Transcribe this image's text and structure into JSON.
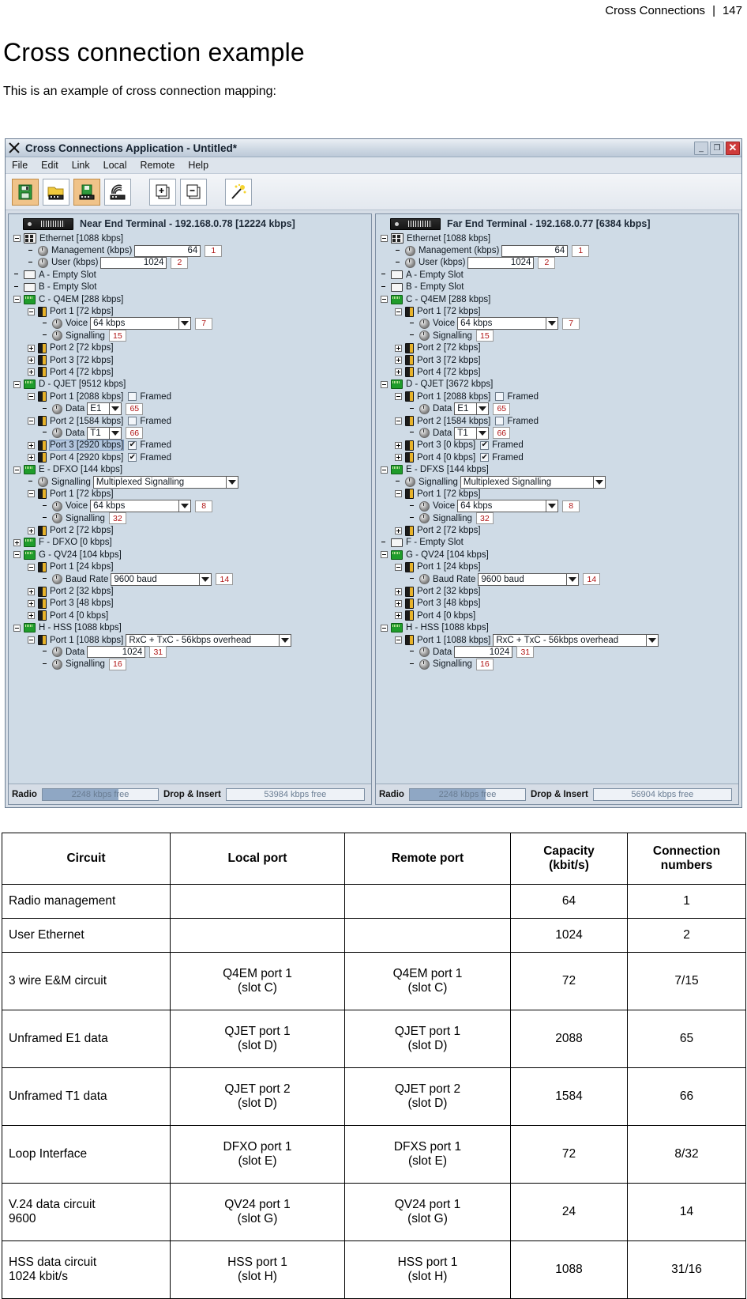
{
  "page_header": {
    "title": "Cross Connections",
    "separator": "|",
    "page_number": "147"
  },
  "document": {
    "heading": "Cross connection example",
    "intro": "This is an example of cross connection mapping:"
  },
  "app": {
    "title": "Cross Connections Application - Untitled*",
    "window_buttons": {
      "minimize": "_",
      "maximize": "❐",
      "close": "✕"
    },
    "menus": [
      "File",
      "Edit",
      "Link",
      "Local",
      "Remote",
      "Help"
    ],
    "toolbar": [
      {
        "name": "save-button",
        "icon": "floppy-disk-icon",
        "active": true
      },
      {
        "name": "open-button",
        "icon": "open-folder-icon",
        "active": false
      },
      {
        "name": "upload-terminal-button",
        "icon": "terminal-save-icon",
        "active": true
      },
      {
        "name": "radio-link-button",
        "icon": "radio-wave-icon",
        "active": false
      },
      {
        "name": "add-connection-button",
        "icon": "add-page-icon",
        "active": false
      },
      {
        "name": "remove-connection-button",
        "icon": "remove-page-icon",
        "active": false
      },
      {
        "name": "wizard-button",
        "icon": "magic-wand-icon",
        "active": false
      }
    ]
  },
  "near_end": {
    "pane_title": "Near End Terminal - 192.168.0.78 [12224 kbps]",
    "tree": [
      {
        "depth": 0,
        "exp": "minus",
        "icon": "ethernet-icon",
        "label": "Ethernet [1088 kbps]"
      },
      {
        "depth": 1,
        "exp": "none",
        "icon": "knob-icon",
        "label": "Management (kbps)",
        "textbox": "64",
        "textbox_w": 84,
        "conn": "1"
      },
      {
        "depth": 1,
        "exp": "none",
        "icon": "knob-icon",
        "label": "User (kbps)",
        "textbox": "1024",
        "textbox_w": 84,
        "conn": "2"
      },
      {
        "depth": 0,
        "exp": "none",
        "icon": "slot-icon",
        "label": "A - Empty Slot"
      },
      {
        "depth": 0,
        "exp": "none",
        "icon": "slot-icon",
        "label": "B - Empty Slot"
      },
      {
        "depth": 0,
        "exp": "minus",
        "icon": "card-icon",
        "label": "C - Q4EM [288 kbps]"
      },
      {
        "depth": 1,
        "exp": "minus",
        "icon": "port-icon",
        "label": "Port 1 [72 kbps]"
      },
      {
        "depth": 2,
        "exp": "none",
        "icon": "knob-icon",
        "label": "Voice",
        "combo": "64 kbps",
        "combo_w": 112,
        "conn": "7"
      },
      {
        "depth": 2,
        "exp": "none",
        "icon": "knob-icon",
        "label": "Signalling",
        "conn": "15"
      },
      {
        "depth": 1,
        "exp": "plus",
        "icon": "port-icon",
        "label": "Port 2 [72 kbps]"
      },
      {
        "depth": 1,
        "exp": "plus",
        "icon": "port-icon",
        "label": "Port 3 [72 kbps]"
      },
      {
        "depth": 1,
        "exp": "plus",
        "icon": "port-icon",
        "label": "Port 4 [72 kbps]"
      },
      {
        "depth": 0,
        "exp": "minus",
        "icon": "card-icon",
        "label": "D - QJET [9512 kbps]"
      },
      {
        "depth": 1,
        "exp": "minus",
        "icon": "port-icon",
        "label": "Port 1 [2088 kbps]",
        "check": false,
        "check_label": "Framed"
      },
      {
        "depth": 2,
        "exp": "none",
        "icon": "knob-icon",
        "label": "Data",
        "combo": "E1",
        "combo_w": 28,
        "conn": "65"
      },
      {
        "depth": 1,
        "exp": "minus",
        "icon": "port-icon",
        "label": "Port 2 [1584 kbps]",
        "check": false,
        "check_label": "Framed"
      },
      {
        "depth": 2,
        "exp": "none",
        "icon": "knob-icon",
        "label": "Data",
        "combo": "T1",
        "combo_w": 28,
        "conn": "66"
      },
      {
        "depth": 1,
        "exp": "plus",
        "icon": "port-icon",
        "label": "Port 3 [2920 kbps]",
        "check": true,
        "check_label": "Framed",
        "selected": true
      },
      {
        "depth": 1,
        "exp": "plus",
        "icon": "port-icon",
        "label": "Port 4 [2920 kbps]",
        "check": true,
        "check_label": "Framed"
      },
      {
        "depth": 0,
        "exp": "minus",
        "icon": "card-icon",
        "label": "E - DFXO [144 kbps]"
      },
      {
        "depth": 1,
        "exp": "none",
        "icon": "knob-icon",
        "label": "Signalling",
        "combo": "Multiplexed Signalling",
        "combo_w": 168
      },
      {
        "depth": 1,
        "exp": "minus",
        "icon": "port-icon",
        "label": "Port 1 [72 kbps]"
      },
      {
        "depth": 2,
        "exp": "none",
        "icon": "knob-icon",
        "label": "Voice",
        "combo": "64 kbps",
        "combo_w": 112,
        "conn": "8"
      },
      {
        "depth": 2,
        "exp": "none",
        "icon": "knob-icon",
        "label": "Signalling",
        "conn": "32"
      },
      {
        "depth": 1,
        "exp": "plus",
        "icon": "port-icon",
        "label": "Port 2 [72 kbps]"
      },
      {
        "depth": 0,
        "exp": "plus",
        "icon": "card-icon",
        "label": "F - DFXO [0 kbps]"
      },
      {
        "depth": 0,
        "exp": "minus",
        "icon": "card-icon",
        "label": "G - QV24 [104 kbps]"
      },
      {
        "depth": 1,
        "exp": "minus",
        "icon": "port-icon",
        "label": "Port 1 [24 kbps]"
      },
      {
        "depth": 2,
        "exp": "none",
        "icon": "knob-icon",
        "label": "Baud Rate",
        "combo": "9600 baud",
        "combo_w": 112,
        "conn": "14"
      },
      {
        "depth": 1,
        "exp": "plus",
        "icon": "port-icon",
        "label": "Port 2 [32 kbps]"
      },
      {
        "depth": 1,
        "exp": "plus",
        "icon": "port-icon",
        "label": "Port 3 [48 kbps]"
      },
      {
        "depth": 1,
        "exp": "plus",
        "icon": "port-icon",
        "label": "Port 4 [0 kbps]"
      },
      {
        "depth": 0,
        "exp": "minus",
        "icon": "card-icon",
        "label": "H - HSS [1088 kbps]"
      },
      {
        "depth": 1,
        "exp": "minus",
        "icon": "port-icon",
        "label": "Port 1 [1088 kbps]",
        "combo": "RxC + TxC - 56kbps overhead",
        "combo_w": 194
      },
      {
        "depth": 2,
        "exp": "none",
        "icon": "knob-icon",
        "label": "Data",
        "textbox": "1024",
        "textbox_w": 74,
        "conn": "31"
      },
      {
        "depth": 2,
        "exp": "none",
        "icon": "knob-icon",
        "label": "Signalling",
        "conn": "16"
      }
    ],
    "status": {
      "radio_label": "Radio",
      "radio_value": "2248 kbps free",
      "radio_fill_pct": 66,
      "drop_label": "Drop & Insert",
      "drop_value": "53984 kbps free",
      "drop_fill_pct": 0
    }
  },
  "far_end": {
    "pane_title": "Far End Terminal - 192.168.0.77 [6384 kbps]",
    "tree": [
      {
        "depth": 0,
        "exp": "minus",
        "icon": "ethernet-icon",
        "label": "Ethernet [1088 kbps]"
      },
      {
        "depth": 1,
        "exp": "none",
        "icon": "knob-icon",
        "label": "Management (kbps)",
        "textbox": "64",
        "textbox_w": 84,
        "conn": "1"
      },
      {
        "depth": 1,
        "exp": "none",
        "icon": "knob-icon",
        "label": "User (kbps)",
        "textbox": "1024",
        "textbox_w": 84,
        "conn": "2"
      },
      {
        "depth": 0,
        "exp": "none",
        "icon": "slot-icon",
        "label": "A - Empty Slot"
      },
      {
        "depth": 0,
        "exp": "none",
        "icon": "slot-icon",
        "label": "B - Empty Slot"
      },
      {
        "depth": 0,
        "exp": "minus",
        "icon": "card-icon",
        "label": "C - Q4EM [288 kbps]"
      },
      {
        "depth": 1,
        "exp": "minus",
        "icon": "port-icon",
        "label": "Port 1 [72 kbps]"
      },
      {
        "depth": 2,
        "exp": "none",
        "icon": "knob-icon",
        "label": "Voice",
        "combo": "64 kbps",
        "combo_w": 112,
        "conn": "7"
      },
      {
        "depth": 2,
        "exp": "none",
        "icon": "knob-icon",
        "label": "Signalling",
        "conn": "15"
      },
      {
        "depth": 1,
        "exp": "plus",
        "icon": "port-icon",
        "label": "Port 2 [72 kbps]"
      },
      {
        "depth": 1,
        "exp": "plus",
        "icon": "port-icon",
        "label": "Port 3 [72 kbps]"
      },
      {
        "depth": 1,
        "exp": "plus",
        "icon": "port-icon",
        "label": "Port 4 [72 kbps]"
      },
      {
        "depth": 0,
        "exp": "minus",
        "icon": "card-icon",
        "label": "D - QJET [3672 kbps]"
      },
      {
        "depth": 1,
        "exp": "minus",
        "icon": "port-icon",
        "label": "Port 1 [2088 kbps]",
        "check": false,
        "check_label": "Framed"
      },
      {
        "depth": 2,
        "exp": "none",
        "icon": "knob-icon",
        "label": "Data",
        "combo": "E1",
        "combo_w": 28,
        "conn": "65"
      },
      {
        "depth": 1,
        "exp": "minus",
        "icon": "port-icon",
        "label": "Port 2 [1584 kbps]",
        "check": false,
        "check_label": "Framed"
      },
      {
        "depth": 2,
        "exp": "none",
        "icon": "knob-icon",
        "label": "Data",
        "combo": "T1",
        "combo_w": 28,
        "conn": "66"
      },
      {
        "depth": 1,
        "exp": "plus",
        "icon": "port-icon",
        "label": "Port 3 [0 kbps]",
        "check": true,
        "check_label": "Framed"
      },
      {
        "depth": 1,
        "exp": "plus",
        "icon": "port-icon",
        "label": "Port 4 [0 kbps]",
        "check": true,
        "check_label": "Framed"
      },
      {
        "depth": 0,
        "exp": "minus",
        "icon": "card-icon",
        "label": "E - DFXS [144 kbps]"
      },
      {
        "depth": 1,
        "exp": "none",
        "icon": "knob-icon",
        "label": "Signalling",
        "combo": "Multiplexed Signalling",
        "combo_w": 168
      },
      {
        "depth": 1,
        "exp": "minus",
        "icon": "port-icon",
        "label": "Port 1 [72 kbps]"
      },
      {
        "depth": 2,
        "exp": "none",
        "icon": "knob-icon",
        "label": "Voice",
        "combo": "64 kbps",
        "combo_w": 112,
        "conn": "8"
      },
      {
        "depth": 2,
        "exp": "none",
        "icon": "knob-icon",
        "label": "Signalling",
        "conn": "32"
      },
      {
        "depth": 1,
        "exp": "plus",
        "icon": "port-icon",
        "label": "Port 2 [72 kbps]"
      },
      {
        "depth": 0,
        "exp": "none",
        "icon": "slot-icon",
        "label": "F - Empty Slot"
      },
      {
        "depth": 0,
        "exp": "minus",
        "icon": "card-icon",
        "label": "G - QV24 [104 kbps]"
      },
      {
        "depth": 1,
        "exp": "minus",
        "icon": "port-icon",
        "label": "Port 1 [24 kbps]"
      },
      {
        "depth": 2,
        "exp": "none",
        "icon": "knob-icon",
        "label": "Baud Rate",
        "combo": "9600 baud",
        "combo_w": 112,
        "conn": "14"
      },
      {
        "depth": 1,
        "exp": "plus",
        "icon": "port-icon",
        "label": "Port 2 [32 kbps]"
      },
      {
        "depth": 1,
        "exp": "plus",
        "icon": "port-icon",
        "label": "Port 3 [48 kbps]"
      },
      {
        "depth": 1,
        "exp": "plus",
        "icon": "port-icon",
        "label": "Port 4 [0 kbps]"
      },
      {
        "depth": 0,
        "exp": "minus",
        "icon": "card-icon",
        "label": "H - HSS [1088 kbps]"
      },
      {
        "depth": 1,
        "exp": "minus",
        "icon": "port-icon",
        "label": "Port 1 [1088 kbps]",
        "combo": "RxC + TxC - 56kbps overhead",
        "combo_w": 194
      },
      {
        "depth": 2,
        "exp": "none",
        "icon": "knob-icon",
        "label": "Data",
        "textbox": "1024",
        "textbox_w": 74,
        "conn": "31"
      },
      {
        "depth": 2,
        "exp": "none",
        "icon": "knob-icon",
        "label": "Signalling",
        "conn": "16"
      }
    ],
    "status": {
      "radio_label": "Radio",
      "radio_value": "2248 kbps free",
      "radio_fill_pct": 66,
      "drop_label": "Drop & Insert",
      "drop_value": "56904 kbps free",
      "drop_fill_pct": 0
    }
  },
  "table": {
    "headers": [
      "Circuit",
      "Local port",
      "Remote port",
      "Capacity (kbit/s)",
      "Connection numbers"
    ],
    "header_lines": [
      [
        "Circuit"
      ],
      [
        "Local port"
      ],
      [
        "Remote port"
      ],
      [
        "Capacity",
        "(kbit/s)"
      ],
      [
        "Connection",
        "numbers"
      ]
    ],
    "rows": [
      {
        "circuit": [
          "Radio management"
        ],
        "local": [
          ""
        ],
        "remote": [
          ""
        ],
        "capacity": "64",
        "numbers": "1",
        "tall": false
      },
      {
        "circuit": [
          "User Ethernet"
        ],
        "local": [
          ""
        ],
        "remote": [
          ""
        ],
        "capacity": "1024",
        "numbers": "2",
        "tall": false
      },
      {
        "circuit": [
          "3 wire E&M circuit"
        ],
        "local": [
          "Q4EM port 1",
          "(slot C)"
        ],
        "remote": [
          "Q4EM port 1",
          "(slot C)"
        ],
        "capacity": "72",
        "numbers": "7/15",
        "tall": true
      },
      {
        "circuit": [
          "Unframed E1 data"
        ],
        "local": [
          "QJET port 1",
          "(slot D)"
        ],
        "remote": [
          "QJET port 1",
          "(slot D)"
        ],
        "capacity": "2088",
        "numbers": "65",
        "tall": true
      },
      {
        "circuit": [
          "Unframed T1 data"
        ],
        "local": [
          "QJET port 2",
          "(slot D)"
        ],
        "remote": [
          "QJET port 2",
          "(slot D)"
        ],
        "capacity": "1584",
        "numbers": "66",
        "tall": true
      },
      {
        "circuit": [
          "Loop Interface"
        ],
        "local": [
          "DFXO port 1",
          "(slot E)"
        ],
        "remote": [
          "DFXS port 1",
          "(slot E)"
        ],
        "capacity": "72",
        "numbers": "8/32",
        "tall": true
      },
      {
        "circuit": [
          "V.24 data circuit",
          "9600"
        ],
        "local": [
          "QV24 port 1",
          "(slot G)"
        ],
        "remote": [
          "QV24 port 1",
          "(slot G)"
        ],
        "capacity": "24",
        "numbers": "14",
        "tall": true
      },
      {
        "circuit": [
          "HSS data circuit",
          "1024 kbit/s"
        ],
        "local": [
          "HSS port 1",
          "(slot H)"
        ],
        "remote": [
          "HSS port 1",
          "(slot H)"
        ],
        "capacity": "1088",
        "numbers": "31/16",
        "tall": true
      }
    ]
  },
  "colors": {
    "pane_bg": "#cfdbe6",
    "conn_number": "#b01616",
    "selection": "#b3c6de",
    "titlebar": "#cfd9e4",
    "close_button": "#cf3b3b"
  }
}
